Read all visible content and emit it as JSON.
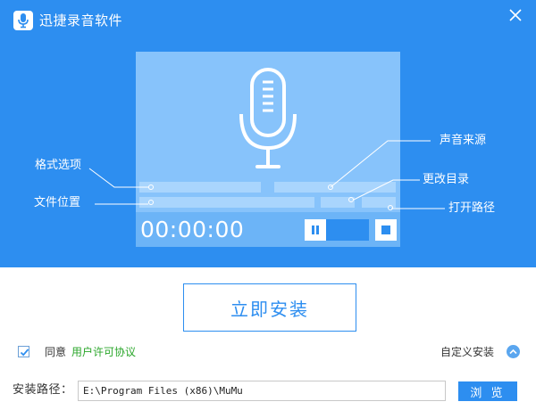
{
  "header": {
    "title": "迅捷录音软件",
    "logo_icon": "microphone-icon",
    "close_icon": "close-icon"
  },
  "preview": {
    "timer": "00:00:00",
    "icon": "microphone-icon",
    "callouts": {
      "format": "格式选项",
      "location": "文件位置",
      "source": "声音来源",
      "change_dir": "更改目录",
      "open_path": "打开路径"
    }
  },
  "install": {
    "button_label": "立即安装",
    "agree_label": "同意",
    "license_link": "用户许可协议",
    "custom_install": "自定义安装",
    "path_label": "安装路径：",
    "path_value": "E:\\Program Files (x86)\\MuMu",
    "browse_label": "浏 览",
    "agree_checked": true
  },
  "colors": {
    "accent": "#2d8ef0",
    "panel": "#87c3fb",
    "link_green": "#2aa62a"
  }
}
